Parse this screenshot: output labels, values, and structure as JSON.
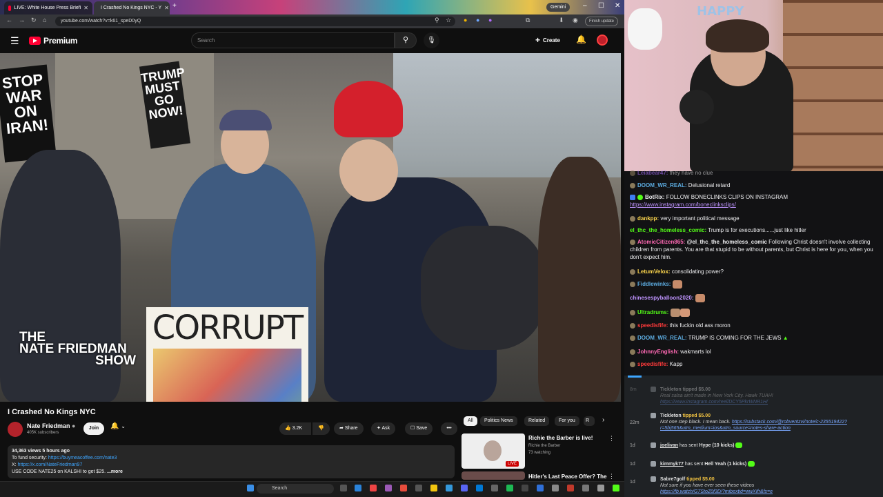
{
  "browser": {
    "tabs": [
      {
        "label": "LIVE: White House Press Briefi",
        "active": false
      },
      {
        "label": "I Crashed No Kings NYC - Y",
        "active": true
      }
    ],
    "gemini": "Gemini",
    "url": "youtube.com/watch?v=k61_speD0yQ",
    "finish_update": "Finish update"
  },
  "youtube": {
    "logo_text": "Premium",
    "search_placeholder": "Search",
    "create_label": "Create",
    "video": {
      "poster_text": "CORRUPT",
      "show_name_line1": "THE",
      "show_name_line2": "NATE FRIEDMAN",
      "show_name_line3": "SHOW",
      "sign1": "STOP WAR ON IRAN!",
      "sign2": "TRUMP MUST GO NOW!"
    },
    "title": "I Crashed No Kings NYC",
    "channel": {
      "name": "Nate Friedman",
      "subs": "405K subscribers",
      "join": "Join"
    },
    "actions": {
      "likes": "3.2K",
      "share": "Share",
      "ask": "Ask",
      "save": "Save"
    },
    "description": {
      "meta": "34,363 views  5 hours ago",
      "line1_label": "To fund security:",
      "line1_link": "https://buymeacoffee.com/nate3",
      "line2_label": "X:",
      "line2_link": "https://x.com/NateFriedman97",
      "line3": "USE CODE NATE25 on KALSHI to get $25.",
      "more": "...more"
    },
    "chips": [
      "All",
      "Politics News",
      "Related",
      "For you",
      "R"
    ],
    "recommendations": [
      {
        "title": "Richie the Barber is live!",
        "channel": "Richie the Barber",
        "watching": "73 watching",
        "badge": "LIVE"
      },
      {
        "title": "Hitler's Last Peace Offer? The"
      }
    ]
  },
  "webcam": {
    "banner": "HAPPY"
  },
  "chat": [
    {
      "user": "Leiabear47:",
      "text": "they have no clue",
      "user_color": "#a970ff"
    },
    {
      "user": "DOOM_WR_REAL:",
      "text": "Delusional retard",
      "user_color": "#5dade2"
    },
    {
      "user": "BotRix:",
      "text": "FOLLOW BONECLINKS CLIPS ON INSTAGRAM",
      "link": "https://www.instagram.com/boneclinksclips/",
      "user_color": "#ffffff"
    },
    {
      "user": "dankpp:",
      "text": "very important political message",
      "user_color": "#ffd84d"
    },
    {
      "user": "el_thc_the_homeless_comic:",
      "text": "Trump is for executions......just like hitler",
      "user_color": "#53fc18"
    },
    {
      "user": "AtomicCitizen865:",
      "mention": "@el_thc_the_homeless_comic",
      "text": "Following Christ doesn't involve collecting children from parents. You are that stupid to be without parents, but Christ is here for you, when you don't expect him.",
      "user_color": "#ff69b4"
    },
    {
      "user": "LetumVelox:",
      "text": "consolidating power?",
      "user_color": "#ffd84d"
    },
    {
      "user": "Fiddlewinks:",
      "text": "",
      "user_color": "#5dade2"
    },
    {
      "user": "chinesespyballoon2020:",
      "text": "",
      "user_color": "#bf94ff"
    },
    {
      "user": "Ultradrums:",
      "text": "",
      "user_color": "#53fc18"
    },
    {
      "user": "speedisfife:",
      "text": "this fuckin old ass moron",
      "user_color": "#ff3a3a"
    },
    {
      "user": "DOOM_WR_REAL:",
      "text": "TRUMP IS COMING FOR THE JEWS",
      "user_color": "#5dade2"
    },
    {
      "user": "JohnnyEnglish:",
      "text": "wakmarts lol",
      "user_color": "#ff69b4"
    },
    {
      "user": "speedisfife:",
      "text": "Kapp",
      "user_color": "#ff3a3a"
    }
  ],
  "events": [
    {
      "time": "8m",
      "user": "Tickleton",
      "action": "tipped $5.00",
      "quote": "Real salsa ain't made in New York City. Hawk TUAH!",
      "link": "https://www.instagram.com/reel/DCY5PkrWNR1H/",
      "faded": true
    },
    {
      "time": "22m",
      "user": "Tickleton",
      "action": "tipped $5.00",
      "quote": "Not one step black. I mean back.",
      "link": "https://substack.com/@robventzvi/note/c-235519422?r=5bj565&utm_medium=ios&utm_source=notes-share-action"
    },
    {
      "time": "1d",
      "user": "joelivan",
      "action": "has sent",
      "gift": "Hype (10 kicks)"
    },
    {
      "time": "1d",
      "user": "kimmyk77",
      "action": "has sent",
      "gift": "Hell Yeah (1 kicks)"
    },
    {
      "time": "1d",
      "user": "Sabre7golf",
      "action": "tipped $5.00",
      "quote": "Not sure if you have ever seen these videos",
      "link": "https://fb.watch/G7StoZ0f3D/?mibextid=wwXIfr&fs=e"
    }
  ],
  "taskbar": {
    "search": "Search"
  }
}
